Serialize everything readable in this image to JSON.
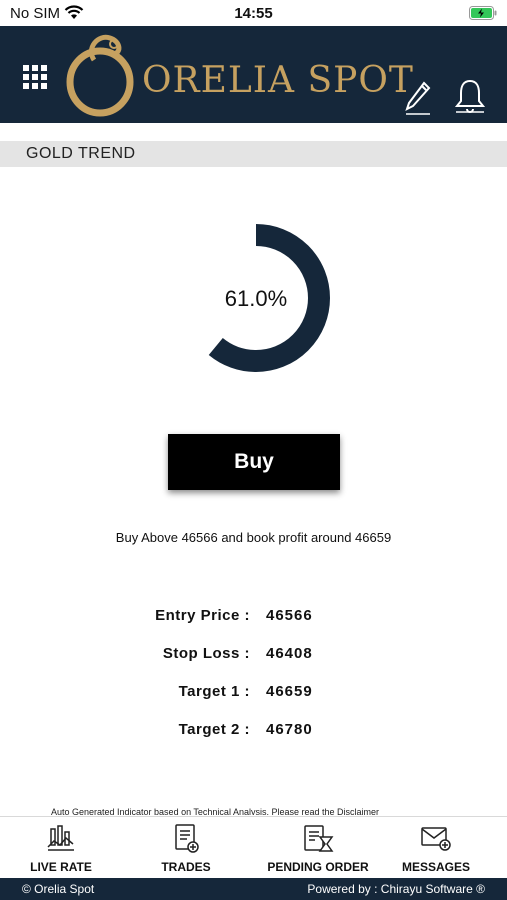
{
  "status": {
    "carrier": "No SIM",
    "time": "14:55"
  },
  "header": {
    "brand": "ORELIA SPOT"
  },
  "section": {
    "title": "GOLD TREND"
  },
  "gauge": {
    "percent_label": "61.0%",
    "percent": 61.0,
    "color": "#15273a"
  },
  "signal": {
    "button_label": "Buy",
    "advice": "Buy Above 46566 and book profit around 46659"
  },
  "levels": [
    {
      "label": "Entry Price :",
      "value": "46566"
    },
    {
      "label": "Stop Loss :",
      "value": "46408"
    },
    {
      "label": "Target 1 :",
      "value": "46659"
    },
    {
      "label": "Target 2 :",
      "value": "46780"
    }
  ],
  "disclaimer": "Auto Generated Indicator based on Technical Analysis. Please read the Disclaimer",
  "tabs": [
    {
      "label": "LIVE RATE",
      "icon": "chart-icon"
    },
    {
      "label": "TRADES",
      "icon": "trades-icon"
    },
    {
      "label": "PENDING ORDER",
      "icon": "pending-order-icon"
    },
    {
      "label": "MESSAGES",
      "icon": "messages-icon"
    }
  ],
  "footer": {
    "left": "© Orelia Spot",
    "right": "Powered by : Chirayu Software ®"
  },
  "colors": {
    "header_bg": "#15273a",
    "brand_gold": "#c6a160",
    "battery_green": "#34c759"
  }
}
